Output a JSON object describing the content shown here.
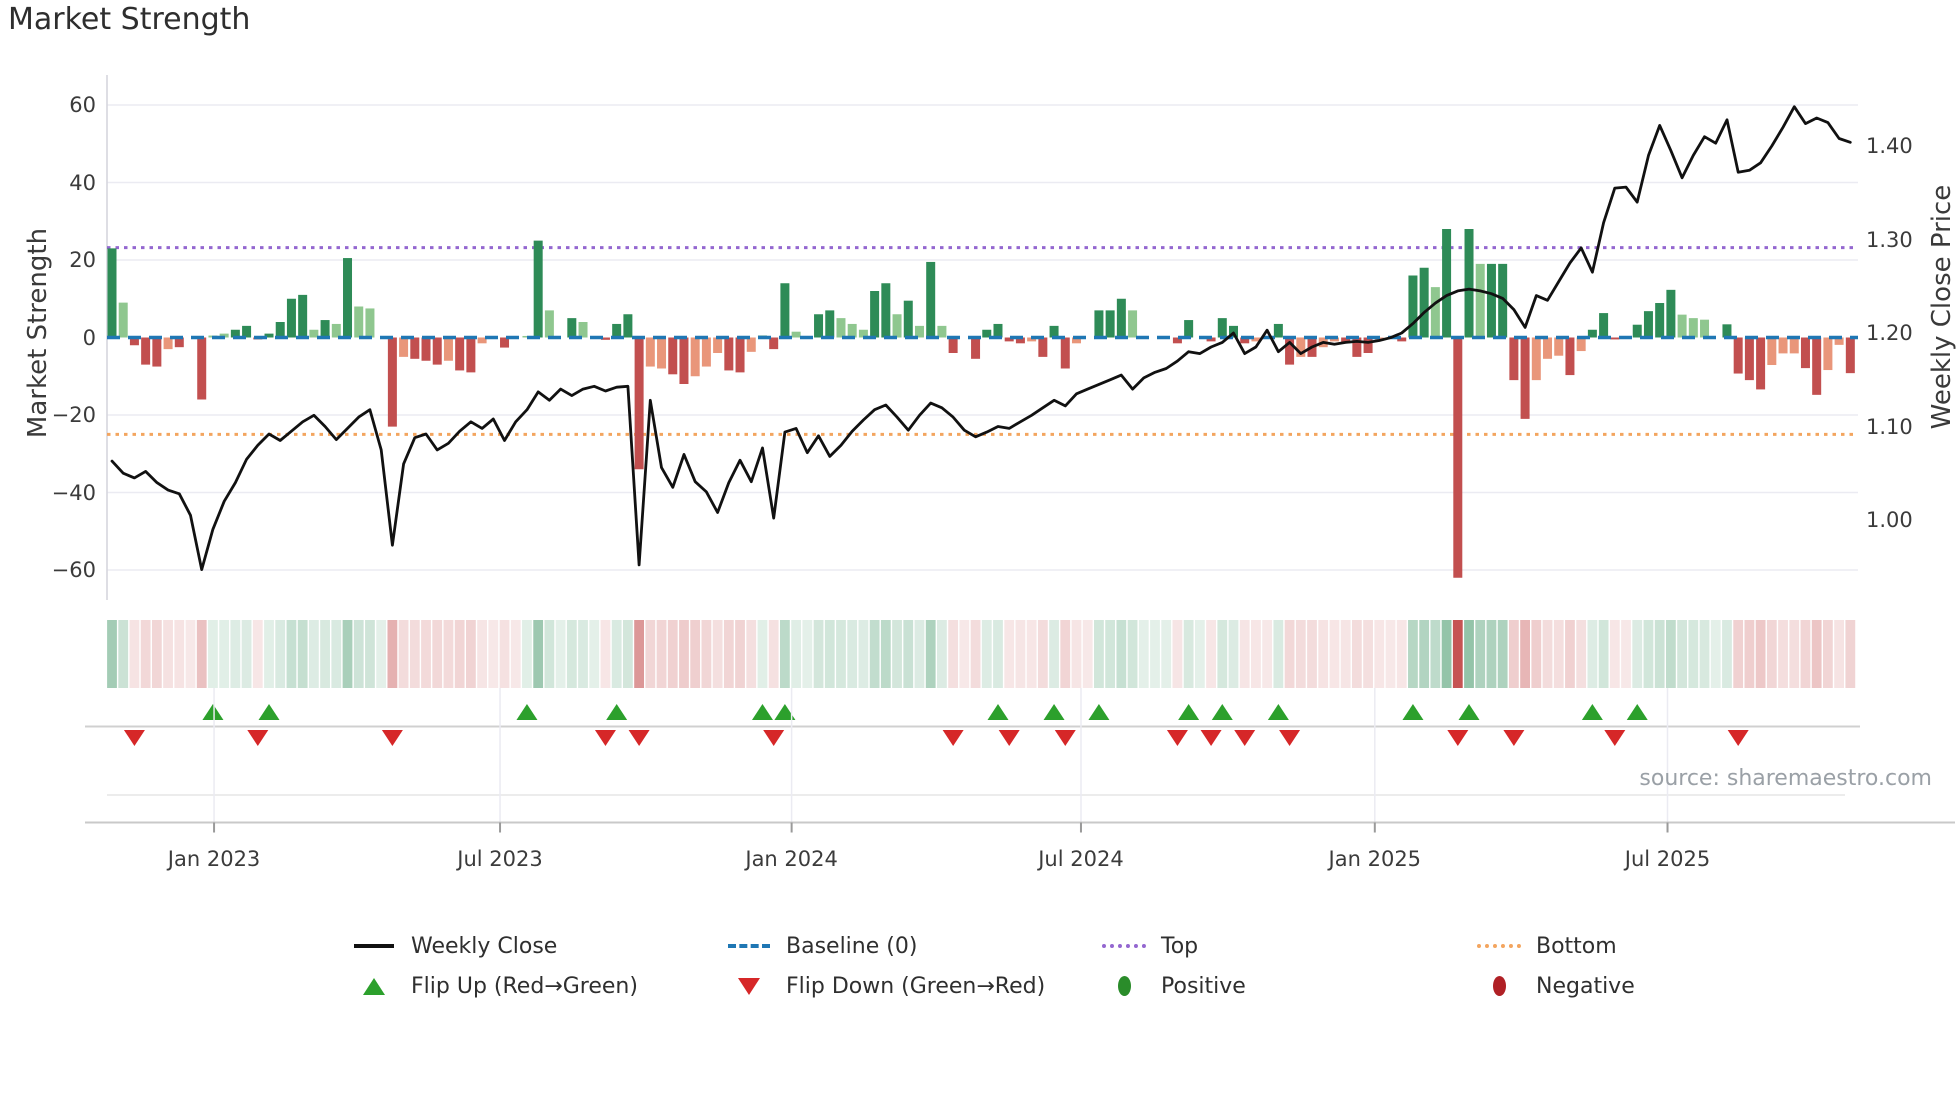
{
  "title": "Market Strength",
  "source": "source: sharemaestro.com",
  "left_axis": {
    "label": "Market Strength",
    "ticks": [
      "60",
      "40",
      "20",
      "0",
      "−20",
      "−40",
      "−60"
    ],
    "tick_values": [
      60,
      40,
      20,
      0,
      -20,
      -40,
      -60
    ]
  },
  "right_axis": {
    "label": "Weekly Close Price",
    "ticks": [
      "1.40",
      "1.30",
      "1.20",
      "1.10",
      "1.00"
    ],
    "tick_values": [
      1.4,
      1.3,
      1.2,
      1.1,
      1.0
    ]
  },
  "x_axis": {
    "ticks": [
      {
        "label": "Jan 2023",
        "week": 9.1
      },
      {
        "label": "Jul 2023",
        "week": 34.6
      },
      {
        "label": "Jan 2024",
        "week": 60.6
      },
      {
        "label": "Jul 2024",
        "week": 86.4
      },
      {
        "label": "Jan 2025",
        "week": 112.6
      },
      {
        "label": "Jul 2025",
        "week": 138.7
      }
    ]
  },
  "legend": {
    "items": [
      {
        "label": "Weekly Close",
        "swatch": "line",
        "color": "#111111"
      },
      {
        "label": "Baseline (0)",
        "swatch": "dashed",
        "color": "#1f77b4"
      },
      {
        "label": "Top",
        "swatch": "dotted",
        "color": "#9467d0"
      },
      {
        "label": "Bottom",
        "swatch": "dotted",
        "color": "#f3a55f"
      },
      {
        "label": "Flip Up (Red→Green)",
        "swatch": "triangle-up",
        "color": "#2ca02c"
      },
      {
        "label": "Flip Down (Green→Red)",
        "swatch": "triangle-down",
        "color": "#d62728"
      },
      {
        "label": "Positive",
        "swatch": "ellipse",
        "color": "#2a8c2a"
      },
      {
        "label": "Negative",
        "swatch": "ellipse",
        "color": "#b02025"
      }
    ]
  },
  "colors": {
    "bar_strong_positive": "#2e8b57",
    "bar_soft_positive": "#8fc78f",
    "bar_strong_negative": "#c24f4f",
    "bar_soft_negative": "#e9967a",
    "price_line": "#111111",
    "baseline": "#1f77b4",
    "top_line": "#9467d0",
    "bottom_line": "#f3a55f",
    "flip_up": "#2ca02c",
    "flip_down": "#d62728",
    "grid": "#ebebf2",
    "spine": "#d4d4dc",
    "axis_line": "#c9c9c9",
    "marker_rule": "#d0d0d0",
    "heat_positive": "46,139,87",
    "heat_negative": "196,78,78"
  },
  "chart_data": {
    "type": "bar+line",
    "x_unit": "week",
    "weeks": 156,
    "title": "Market Strength",
    "ylabel_left": "Market Strength",
    "ylabel_right": "Weekly Close Price",
    "ylim_left": [
      -68,
      68
    ],
    "baseline": 0,
    "top_line": 23.2,
    "bottom_line": -25,
    "grid": true,
    "legend_position": "bottom",
    "series": [
      {
        "name": "Market Strength",
        "type": "bar",
        "axis": "left",
        "values": [
          23,
          9,
          -2,
          -7,
          -7.5,
          -3,
          -2.5,
          0,
          -16,
          0.5,
          1,
          2,
          3,
          -0.5,
          1,
          4,
          10,
          11,
          2,
          4.5,
          3.5,
          20.5,
          8,
          7.5,
          0,
          -23,
          -5,
          -5.5,
          -6,
          -7,
          -6,
          -8.5,
          -9,
          -1.5,
          0,
          -2.6,
          0,
          0.4,
          25,
          7,
          0,
          5,
          4,
          0,
          -0.6,
          3.5,
          6,
          -34,
          -7.5,
          -8,
          -9.5,
          -12,
          -10,
          -7.5,
          -4,
          -8.5,
          -9,
          -3.7,
          0.5,
          -3,
          14,
          1.5,
          0,
          6,
          7,
          5,
          3.5,
          2,
          12,
          14,
          6,
          9.5,
          3,
          19.5,
          3,
          -4,
          0,
          -5.5,
          2,
          3.5,
          -1,
          -1.5,
          -1,
          -5,
          3,
          -8,
          -1.5,
          0,
          7,
          7,
          10,
          7,
          0,
          0,
          0,
          -1.5,
          4.5,
          0,
          -1,
          5,
          3,
          -1.5,
          -1,
          0,
          3.5,
          -7,
          -5,
          -5,
          -2.5,
          -1,
          -1.5,
          -5,
          -4,
          -0.8,
          0,
          -1,
          16,
          18,
          13,
          28,
          -62,
          28,
          19,
          19,
          19,
          -11,
          -21,
          -11,
          -5.5,
          -4.7,
          -9.7,
          -3.5,
          2,
          6.3,
          -0.5,
          0,
          3.3,
          6.8,
          8.9,
          12.3,
          5.9,
          5,
          4.6,
          0,
          3.4,
          -9.3,
          -11,
          -13.4,
          -7.1,
          -4.1,
          -4.1,
          -7.9,
          -14.8,
          -8.4,
          -1.9,
          -9.2
        ]
      },
      {
        "name": "Weekly Close",
        "type": "line",
        "axis": "right",
        "values": [
          1.063,
          1.05,
          1.045,
          1.052,
          1.04,
          1.032,
          1.028,
          1.005,
          0.947,
          0.99,
          1.02,
          1.04,
          1.065,
          1.08,
          1.092,
          1.085,
          1.095,
          1.105,
          1.112,
          1.1,
          1.086,
          1.098,
          1.11,
          1.118,
          1.075,
          0.973,
          1.06,
          1.088,
          1.092,
          1.075,
          1.082,
          1.095,
          1.105,
          1.098,
          1.108,
          1.085,
          1.105,
          1.118,
          1.137,
          1.128,
          1.14,
          1.133,
          1.14,
          1.143,
          1.138,
          1.142,
          1.143,
          0.952,
          1.128,
          1.056,
          1.035,
          1.07,
          1.041,
          1.03,
          1.008,
          1.04,
          1.064,
          1.041,
          1.077,
          1.002,
          1.094,
          1.098,
          1.072,
          1.09,
          1.068,
          1.08,
          1.095,
          1.107,
          1.118,
          1.123,
          1.11,
          1.096,
          1.112,
          1.125,
          1.12,
          1.11,
          1.096,
          1.089,
          1.094,
          1.1,
          1.098,
          1.105,
          1.112,
          1.12,
          1.128,
          1.122,
          1.135,
          1.14,
          1.145,
          1.15,
          1.155,
          1.14,
          1.152,
          1.158,
          1.162,
          1.17,
          1.18,
          1.178,
          1.185,
          1.19,
          1.2,
          1.178,
          1.185,
          1.203,
          1.18,
          1.19,
          1.178,
          1.185,
          1.19,
          1.188,
          1.19,
          1.191,
          1.19,
          1.192,
          1.195,
          1.2,
          1.21,
          1.222,
          1.232,
          1.24,
          1.245,
          1.247,
          1.245,
          1.242,
          1.237,
          1.225,
          1.206,
          1.24,
          1.235,
          1.255,
          1.275,
          1.291,
          1.265,
          1.318,
          1.355,
          1.356,
          1.34,
          1.39,
          1.422,
          1.395,
          1.366,
          1.39,
          1.41,
          1.403,
          1.428,
          1.372,
          1.374,
          1.382,
          1.4,
          1.42,
          1.442,
          1.424,
          1.43,
          1.425,
          1.408,
          1.404
        ]
      }
    ],
    "bar_shades": "DLRRRSR0RLLDDRDDDDLDLDLL0RSRRRSRRS0R0LDL0DL0RDDRSSRRSSSRRSDRDL0DDLLLDDLDLDLR0RDDRRSRDRS0DDDL000RD0RDDRS0DRSRSSRRRS0RDDLDRDLDDRRSSSRSDDR0DDDDLLL0DRRRSSSRRSSR",
    "shade_legend": {
      "D": "strong positive (dark green)",
      "L": "soft positive (light green)",
      "R": "strong negative (dark red)",
      "S": "soft negative (salmon)",
      "0": "no bar"
    },
    "flip_up_weeks": [
      9,
      14,
      37,
      45,
      58,
      60,
      79,
      84,
      88,
      96,
      99,
      104,
      116,
      121,
      132,
      136
    ],
    "flip_down_weeks": [
      2,
      13,
      25,
      44,
      47,
      59,
      75,
      80,
      85,
      95,
      98,
      101,
      105,
      120,
      125,
      134,
      145
    ]
  }
}
